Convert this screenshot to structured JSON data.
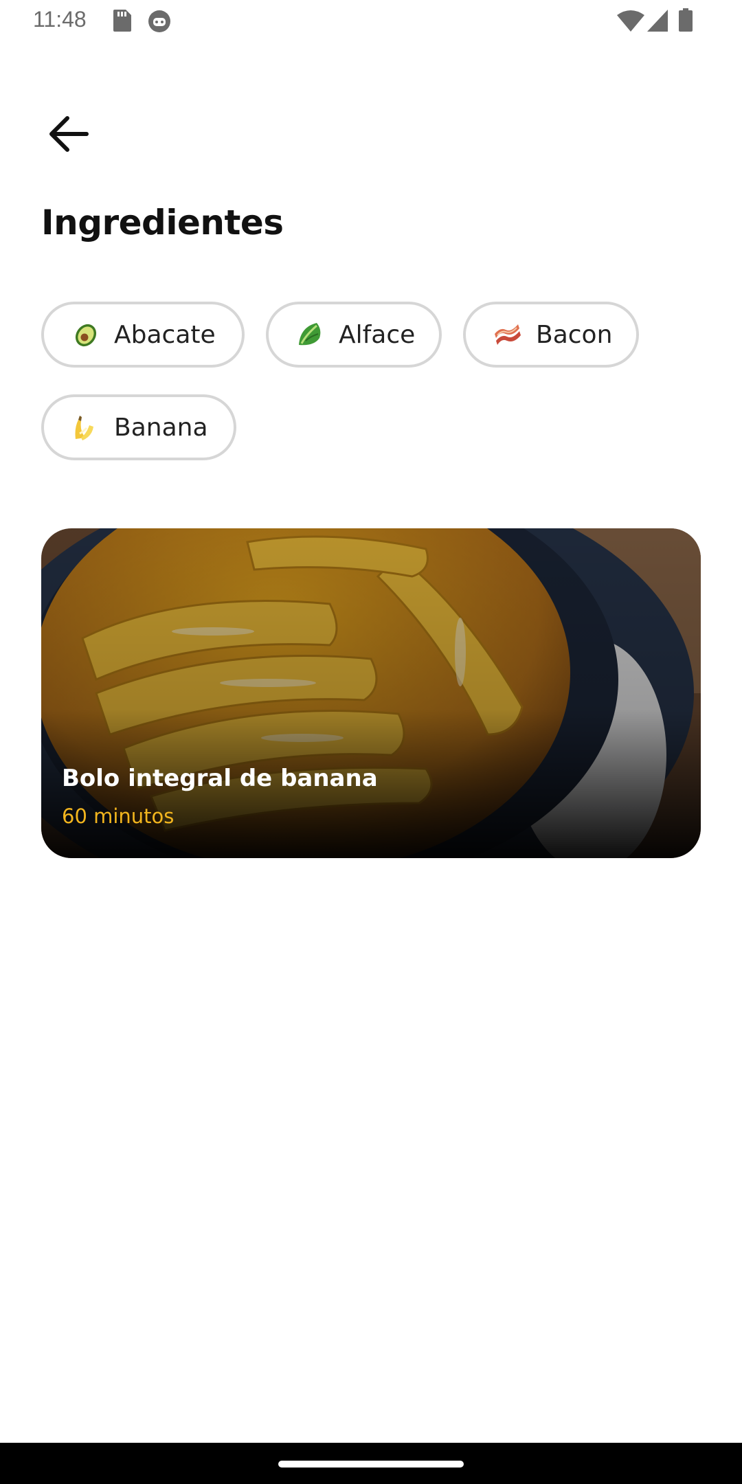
{
  "status_bar": {
    "time": "11:48",
    "left_icons": [
      "sd-card-icon",
      "robot-icon"
    ],
    "right_icons": [
      "wifi-icon",
      "signal-icon",
      "battery-icon"
    ]
  },
  "header": {
    "back_icon": "arrow-left-icon",
    "title": "Ingredientes"
  },
  "ingredients": [
    {
      "label": "Abacate",
      "icon": "avocado-icon"
    },
    {
      "label": "Alface",
      "icon": "lettuce-icon"
    },
    {
      "label": "Bacon",
      "icon": "bacon-icon"
    },
    {
      "label": "Banana",
      "icon": "banana-icon"
    }
  ],
  "recipe": {
    "title": "Bolo integral de banana",
    "time": "60 minutos",
    "image": "banana-cake-photo"
  },
  "colors": {
    "accent": "#f2b51e",
    "chip_border": "#d6d6d6",
    "text": "#111111",
    "background": "#ffffff"
  }
}
